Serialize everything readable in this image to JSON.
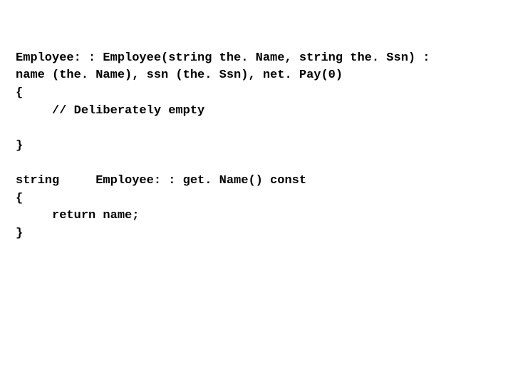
{
  "code": {
    "line1": "Employee: : Employee(string the. Name, string the. Ssn) :",
    "line2": "name (the. Name), ssn (the. Ssn), net. Pay(0)",
    "line3": "{",
    "line4": "     // Deliberately empty",
    "line5": "",
    "line6": "}",
    "line7": "",
    "line8": "string     Employee: : get. Name() const",
    "line9": "{",
    "line10": "     return name;",
    "line11": "}"
  }
}
